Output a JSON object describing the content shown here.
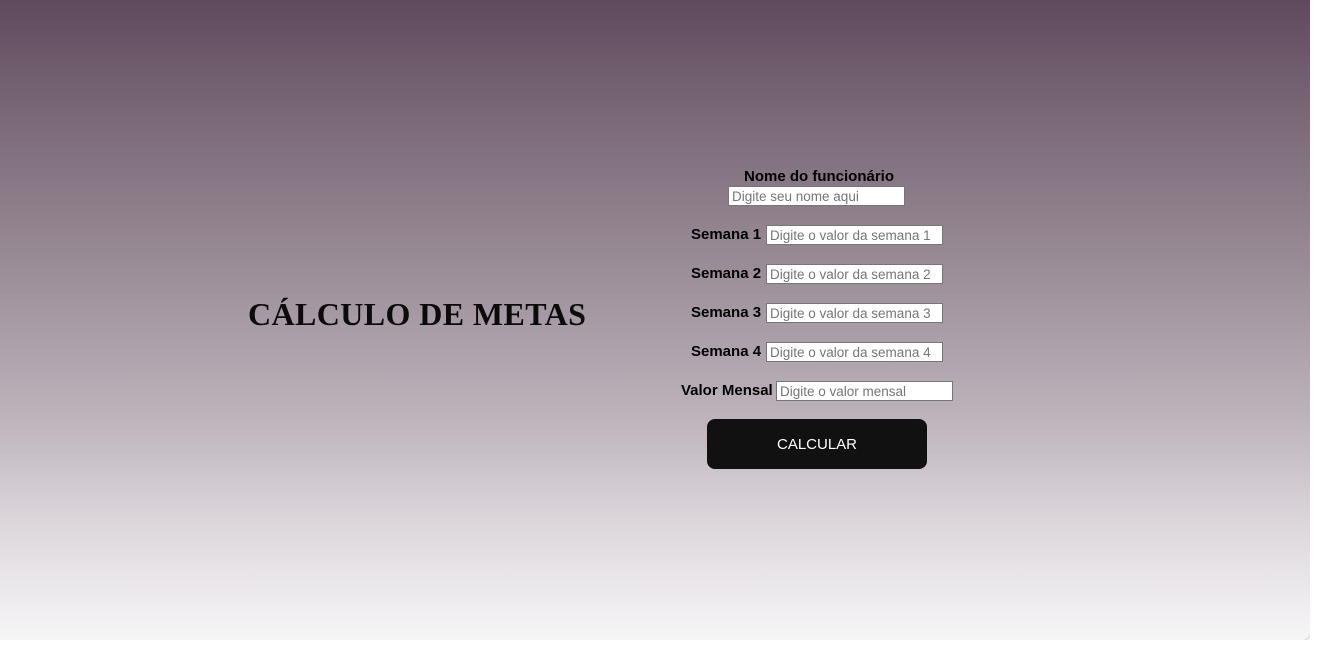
{
  "page": {
    "title": "CÁLCULO DE METAS"
  },
  "form": {
    "name": {
      "label": "Nome do funcionário",
      "placeholder": "Digite seu nome aqui",
      "value": ""
    },
    "weeks": [
      {
        "label": "Semana 1",
        "placeholder": "Digite o valor da semana 1",
        "value": ""
      },
      {
        "label": "Semana 2",
        "placeholder": "Digite o valor da semana 2",
        "value": ""
      },
      {
        "label": "Semana 3",
        "placeholder": "Digite o valor da semana 3",
        "value": ""
      },
      {
        "label": "Semana 4",
        "placeholder": "Digite o valor da semana 4",
        "value": ""
      }
    ],
    "monthly": {
      "label": "Valor Mensal",
      "placeholder": "Digite o valor mensal",
      "value": ""
    },
    "submit_label": "CALCULAR"
  },
  "colors": {
    "gradient_top": "#5f4a5c",
    "gradient_bottom": "#f7f6f7",
    "button_bg": "#111111",
    "button_text": "#ffffff"
  }
}
